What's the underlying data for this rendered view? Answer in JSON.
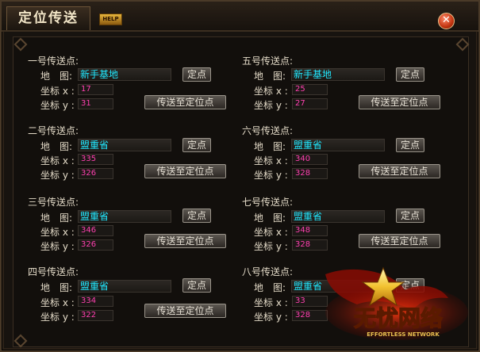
{
  "window": {
    "title": "定位传送",
    "help_label": "HELP",
    "close_glyph": "✕"
  },
  "labels": {
    "map": "地　图:",
    "coord_x": "坐标 x :",
    "coord_y": "坐标 y :",
    "locate_button": "定点",
    "teleport_button": "传送至定位点"
  },
  "points": [
    {
      "title": "一号传送点:",
      "map": "新手基地",
      "x": "17",
      "y": "31"
    },
    {
      "title": "五号传送点:",
      "map": "新手基地",
      "x": "25",
      "y": "27"
    },
    {
      "title": "二号传送点:",
      "map": "盟重省",
      "x": "335",
      "y": "326"
    },
    {
      "title": "六号传送点:",
      "map": "盟重省",
      "x": "340",
      "y": "328"
    },
    {
      "title": "三号传送点:",
      "map": "盟重省",
      "x": "346",
      "y": "326"
    },
    {
      "title": "七号传送点:",
      "map": "盟重省",
      "x": "348",
      "y": "328"
    },
    {
      "title": "四号传送点:",
      "map": "盟重省",
      "x": "334",
      "y": "322"
    },
    {
      "title": "八号传送点:",
      "map": "盟重省",
      "x": "33",
      "y": "328"
    }
  ],
  "logo": {
    "text": "无忧网络",
    "subtext": "EFFORTLESS NETWORK"
  },
  "colors": {
    "map_text": "#20e8ff",
    "coord_text": "#ff40b0",
    "label_text": "#e4dbc8"
  }
}
